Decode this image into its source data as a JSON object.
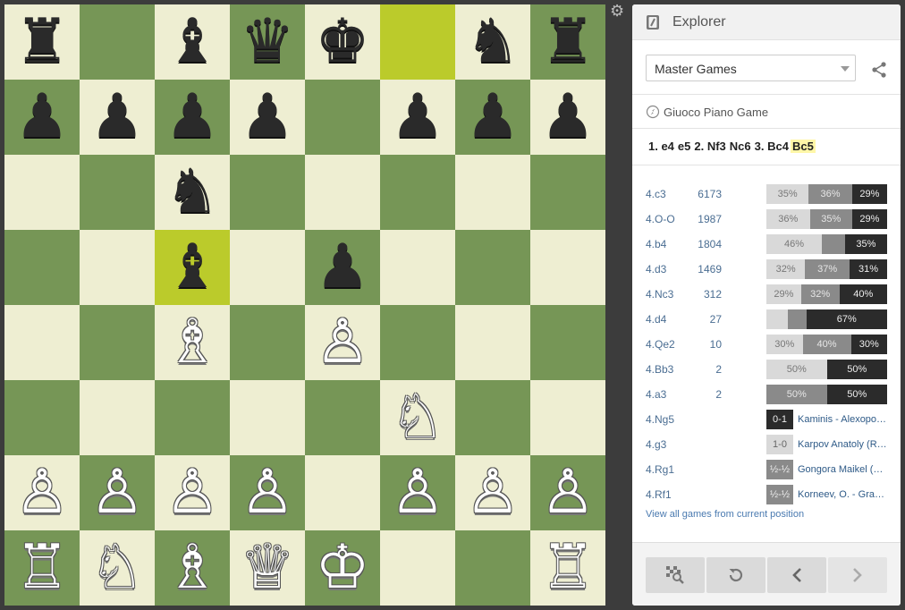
{
  "board": {
    "rows": [
      [
        {
          "p": "♜",
          "c": "b"
        },
        {
          "p": "",
          "c": ""
        },
        {
          "p": "♝",
          "c": "b"
        },
        {
          "p": "♛",
          "c": "b"
        },
        {
          "p": "♚",
          "c": "b"
        },
        {
          "p": "",
          "c": ""
        },
        {
          "p": "♞",
          "c": "b"
        },
        {
          "p": "♜",
          "c": "b"
        }
      ],
      [
        {
          "p": "♟",
          "c": "b"
        },
        {
          "p": "♟",
          "c": "b"
        },
        {
          "p": "♟",
          "c": "b"
        },
        {
          "p": "♟",
          "c": "b"
        },
        {
          "p": "",
          "c": ""
        },
        {
          "p": "♟",
          "c": "b"
        },
        {
          "p": "♟",
          "c": "b"
        },
        {
          "p": "♟",
          "c": "b"
        }
      ],
      [
        {
          "p": "",
          "c": ""
        },
        {
          "p": "",
          "c": ""
        },
        {
          "p": "♞",
          "c": "b"
        },
        {
          "p": "",
          "c": ""
        },
        {
          "p": "",
          "c": ""
        },
        {
          "p": "",
          "c": ""
        },
        {
          "p": "",
          "c": ""
        },
        {
          "p": "",
          "c": ""
        }
      ],
      [
        {
          "p": "",
          "c": ""
        },
        {
          "p": "",
          "c": ""
        },
        {
          "p": "♝",
          "c": "b"
        },
        {
          "p": "",
          "c": ""
        },
        {
          "p": "♟",
          "c": "b"
        },
        {
          "p": "",
          "c": ""
        },
        {
          "p": "",
          "c": ""
        },
        {
          "p": "",
          "c": ""
        }
      ],
      [
        {
          "p": "",
          "c": ""
        },
        {
          "p": "",
          "c": ""
        },
        {
          "p": "♗",
          "c": "w"
        },
        {
          "p": "",
          "c": ""
        },
        {
          "p": "♙",
          "c": "w"
        },
        {
          "p": "",
          "c": ""
        },
        {
          "p": "",
          "c": ""
        },
        {
          "p": "",
          "c": ""
        }
      ],
      [
        {
          "p": "",
          "c": ""
        },
        {
          "p": "",
          "c": ""
        },
        {
          "p": "",
          "c": ""
        },
        {
          "p": "",
          "c": ""
        },
        {
          "p": "",
          "c": ""
        },
        {
          "p": "♘",
          "c": "w"
        },
        {
          "p": "",
          "c": ""
        },
        {
          "p": "",
          "c": ""
        }
      ],
      [
        {
          "p": "♙",
          "c": "w"
        },
        {
          "p": "♙",
          "c": "w"
        },
        {
          "p": "♙",
          "c": "w"
        },
        {
          "p": "♙",
          "c": "w"
        },
        {
          "p": "",
          "c": ""
        },
        {
          "p": "♙",
          "c": "w"
        },
        {
          "p": "♙",
          "c": "w"
        },
        {
          "p": "♙",
          "c": "w"
        }
      ],
      [
        {
          "p": "♖",
          "c": "w"
        },
        {
          "p": "♘",
          "c": "w"
        },
        {
          "p": "♗",
          "c": "w"
        },
        {
          "p": "♕",
          "c": "w"
        },
        {
          "p": "♔",
          "c": "w"
        },
        {
          "p": "",
          "c": ""
        },
        {
          "p": "",
          "c": ""
        },
        {
          "p": "♖",
          "c": "w"
        }
      ]
    ],
    "highlighted": [
      [
        0,
        5
      ],
      [
        3,
        2
      ]
    ],
    "colors": {
      "light": "#eeeed2",
      "dark": "#769656",
      "highlight": "#bbcb2b"
    }
  },
  "explorer": {
    "title": "Explorer",
    "database_select": "Master Games",
    "opening_name": "Giuoco Piano Game",
    "move_sequence": [
      "1. e4",
      "e5",
      "2. Nf3",
      "Nc6",
      "3. Bc4",
      "Bc5"
    ],
    "current_move_index": 5,
    "moves": [
      {
        "move": "4.c3",
        "count": "6173",
        "white": 35,
        "draw": 36,
        "black": 29,
        "lw": "35%",
        "ld": "36%",
        "lb": "29%"
      },
      {
        "move": "4.O-O",
        "count": "1987",
        "white": 36,
        "draw": 35,
        "black": 29,
        "lw": "36%",
        "ld": "35%",
        "lb": "29%"
      },
      {
        "move": "4.b4",
        "count": "1804",
        "white": 46,
        "draw": 19,
        "black": 35,
        "lw": "46%",
        "ld": "",
        "lb": "35%"
      },
      {
        "move": "4.d3",
        "count": "1469",
        "white": 32,
        "draw": 37,
        "black": 31,
        "lw": "32%",
        "ld": "37%",
        "lb": "31%"
      },
      {
        "move": "4.Nc3",
        "count": "312",
        "white": 29,
        "draw": 32,
        "black": 40,
        "lw": "29%",
        "ld": "32%",
        "lb": "40%"
      },
      {
        "move": "4.d4",
        "count": "27",
        "white": 18,
        "draw": 15,
        "black": 67,
        "lw": "",
        "ld": "",
        "lb": "67%"
      },
      {
        "move": "4.Qe2",
        "count": "10",
        "white": 30,
        "draw": 40,
        "black": 30,
        "lw": "30%",
        "ld": "40%",
        "lb": "30%"
      },
      {
        "move": "4.Bb3",
        "count": "2",
        "white": 50,
        "draw": 0,
        "black": 50,
        "lw": "50%",
        "ld": "",
        "lb": "50%"
      },
      {
        "move": "4.a3",
        "count": "2",
        "white": 0,
        "draw": 50,
        "black": 50,
        "lw": "",
        "ld": "50%",
        "lb": "50%"
      }
    ],
    "games": [
      {
        "move": "4.Ng5",
        "result": "0-1",
        "kind": "blk",
        "players": "Kaminis - Alexopoul..."
      },
      {
        "move": "4.g3",
        "result": "1-0",
        "kind": "wht",
        "players": "Karpov Anatoly (RU..."
      },
      {
        "move": "4.Rg1",
        "result": "½-½",
        "kind": "drw",
        "players": "Gongora Maikel (CU..."
      },
      {
        "move": "4.Rf1",
        "result": "½-½",
        "kind": "drw",
        "players": "Korneev, O. - Grand..."
      }
    ],
    "view_all": "View all games from current position",
    "footer_buttons": [
      "analysis-board-icon",
      "reset-icon",
      "previous-icon",
      "next-icon"
    ]
  }
}
